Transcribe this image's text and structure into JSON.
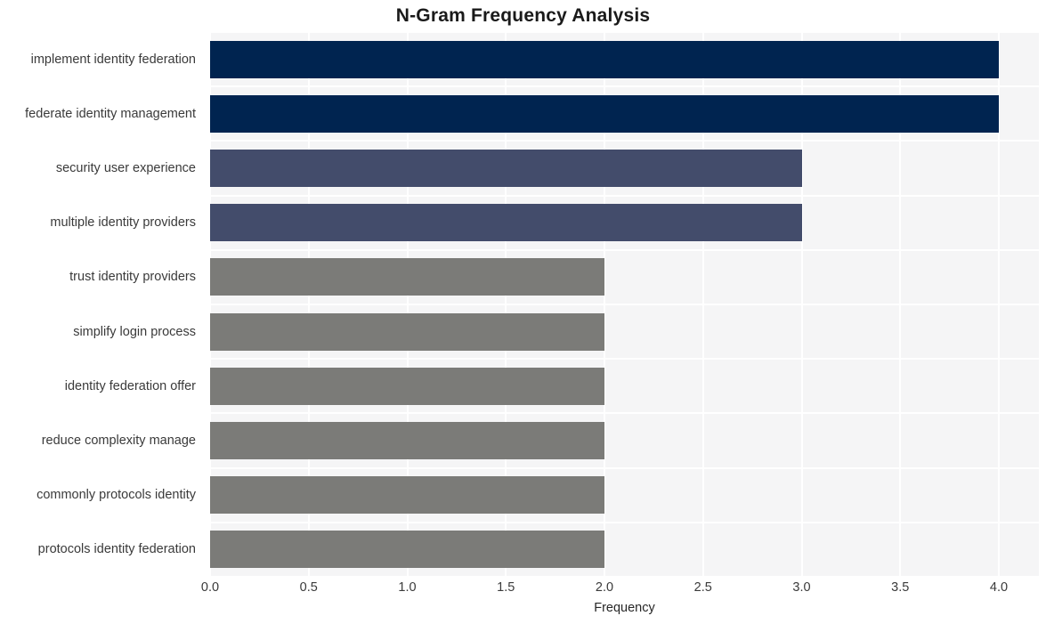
{
  "chart_data": {
    "type": "bar",
    "orientation": "horizontal",
    "title": "N-Gram Frequency Analysis",
    "xlabel": "Frequency",
    "ylabel": "",
    "xlim": [
      0,
      4
    ],
    "ylim": null,
    "grid": true,
    "legend": null,
    "xticks": [
      "0.0",
      "0.5",
      "1.0",
      "1.5",
      "2.0",
      "2.5",
      "3.0",
      "3.5",
      "4.0"
    ],
    "xtick_values": [
      0.0,
      0.5,
      1.0,
      1.5,
      2.0,
      2.5,
      3.0,
      3.5,
      4.0
    ],
    "categories": [
      "implement identity federation",
      "federate identity management",
      "security user experience",
      "multiple identity providers",
      "trust identity providers",
      "simplify login process",
      "identity federation offer",
      "reduce complexity manage",
      "commonly protocols identity",
      "protocols identity federation"
    ],
    "values": [
      4,
      4,
      3,
      3,
      2,
      2,
      2,
      2,
      2,
      2
    ],
    "bar_colors": [
      "#002450",
      "#002450",
      "#434c6b",
      "#434c6b",
      "#7b7b78",
      "#7b7b78",
      "#7b7b78",
      "#7b7b78",
      "#7b7b78",
      "#7b7b78"
    ],
    "plot_background": "#f5f5f6",
    "gridline_color": "#ffffff",
    "figure_background": "#ffffff",
    "text_color": "#3a3a3a",
    "title_color": "#1a1a1a"
  }
}
